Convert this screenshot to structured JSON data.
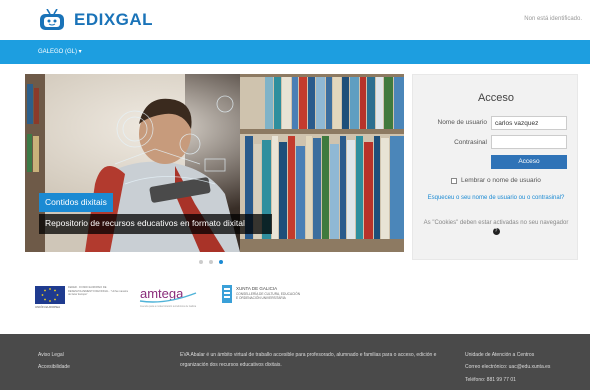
{
  "header": {
    "brand": "EDIXGAL",
    "login_status": "Non está identificado."
  },
  "navbar": {
    "language_label": "GALEGO (GL) ▾"
  },
  "slider": {
    "caption_title": "Contidos dixitais",
    "caption_text": "Repositorio de recursos educativos en formato dixital",
    "dots": 3,
    "active_dot": 3
  },
  "login": {
    "title": "Acceso",
    "username_label": "Nome de usuario",
    "username_value": "carlos vazquez",
    "password_label": "Contrasinal",
    "password_value": "",
    "submit_label": "Acceso",
    "remember_label": "Lembrar o nome de usuario",
    "forgot_link": "Esqueceu o seu nome de usuario ou o contrasinal?",
    "cookies_text": "As \"Cookies\" deben estar activadas no seu navegador",
    "help_icon": "?"
  },
  "partners": {
    "eu_text": "FEDER · FONDO EUROPEO DE DESENVOLVEMENTO REXIONAL · \"Unha maneira de facer Europa\"",
    "eu_caption": "UNIÓN EUROPEA",
    "amtega": "amtega",
    "amtega_sub": "Axencia para a modernización tecnolóxica de Galicia",
    "xunta_title": "XUNTA DE GALICIA",
    "xunta_sub1": "CONSELLERÍA DE CULTURA, EDUCACIÓN",
    "xunta_sub2": "E ORDENACIÓN UNIVERSITARIA"
  },
  "footer": {
    "link1": "Aviso Legal",
    "link2": "Accesibilidade",
    "description": "EVA Abalar é un ámbito virtual de traballo accesible para profesorado, alumnado e familias para o acceso, edición e organización dos recursos educativos dixitais.",
    "contact_title": "Unidade de Atención a Centros",
    "contact_email": "Correo electrónico: uac@edu.xunta.es",
    "contact_phone": "Teléfono: 881 99 77 01"
  },
  "colors": {
    "brand_blue": "#1a73b8",
    "navbar": "#1d9ee0",
    "button": "#2f73b7",
    "footer": "#4a4a4a"
  }
}
